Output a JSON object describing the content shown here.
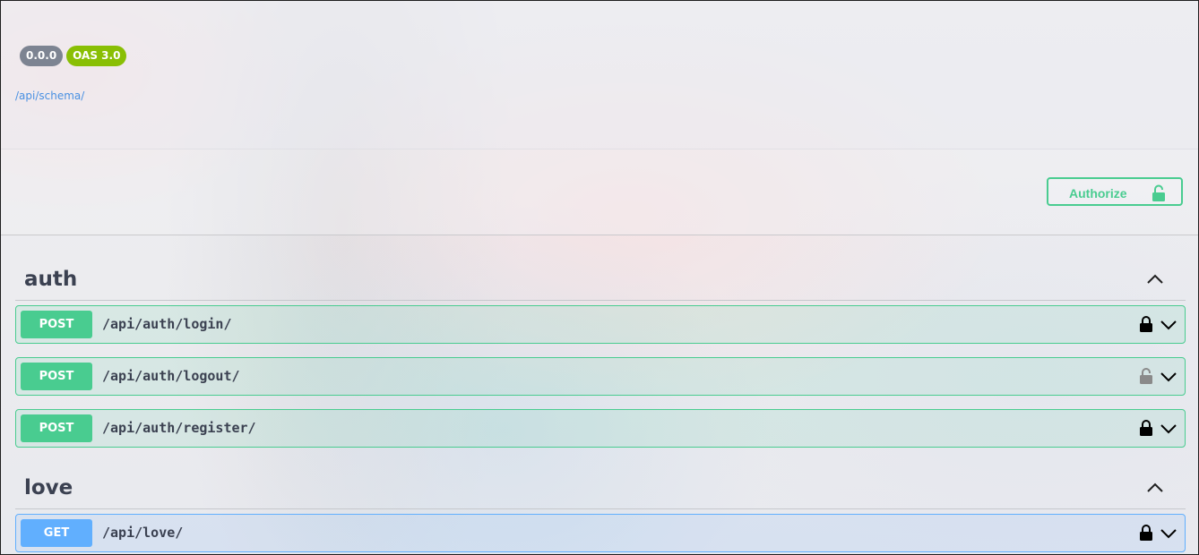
{
  "info": {
    "version": "0.0.0",
    "oas": "OAS 3.0",
    "schema_link": "/api/schema/"
  },
  "auth_button": {
    "label": "Authorize",
    "icon": "unlocked-icon",
    "color": "#49cc90"
  },
  "tags": [
    {
      "name": "auth",
      "operations": [
        {
          "method": "POST",
          "path": "/api/auth/login/",
          "lock": "locked"
        },
        {
          "method": "POST",
          "path": "/api/auth/logout/",
          "lock": "unlocked"
        },
        {
          "method": "POST",
          "path": "/api/auth/register/",
          "lock": "locked"
        }
      ]
    },
    {
      "name": "love",
      "operations": [
        {
          "method": "GET",
          "path": "/api/love/",
          "lock": "locked"
        }
      ]
    }
  ],
  "colors": {
    "post": "#49cc90",
    "get": "#61affe",
    "version_badge": "#7d8492",
    "oas_badge": "#89bf04",
    "link": "#4990e2"
  }
}
